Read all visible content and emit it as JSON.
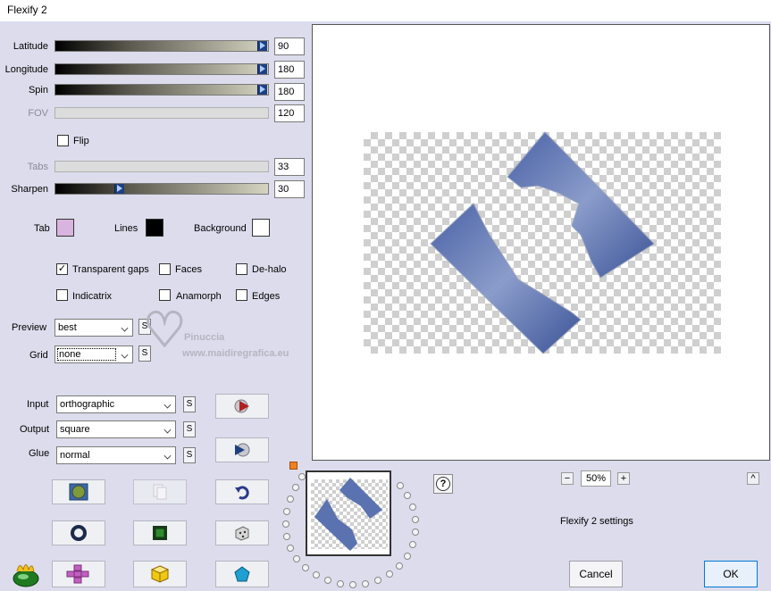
{
  "window": {
    "title": "Flexify 2"
  },
  "sliders": [
    {
      "label": "Latitude",
      "value": "90",
      "level_percent": 100,
      "enabled": true
    },
    {
      "label": "Longitude",
      "value": "180",
      "level_percent": 100,
      "enabled": true
    },
    {
      "label": "Spin",
      "value": "180",
      "level_percent": 100,
      "enabled": true
    },
    {
      "label": "FOV",
      "value": "120",
      "level_percent": 0,
      "enabled": false
    },
    {
      "label": "Tabs",
      "value": "33",
      "level_percent": 0,
      "enabled": false
    },
    {
      "label": "Sharpen",
      "value": "30",
      "level_percent": 30,
      "enabled": true
    }
  ],
  "flip": {
    "label": "Flip",
    "checked": false
  },
  "colors": {
    "tab": {
      "label": "Tab",
      "color": "#d9b4de"
    },
    "lines": {
      "label": "Lines",
      "color": "#000000"
    },
    "background": {
      "label": "Background",
      "color": "#ffffff"
    }
  },
  "options": {
    "transparent_gaps": {
      "label": "Transparent gaps",
      "checked": true
    },
    "faces": {
      "label": "Faces",
      "checked": false
    },
    "de_halo": {
      "label": "De-halo",
      "checked": false
    },
    "indicatrix": {
      "label": "Indicatrix",
      "checked": false
    },
    "anamorph": {
      "label": "Anamorph",
      "checked": false
    },
    "edges": {
      "label": "Edges",
      "checked": false
    }
  },
  "preview_select": {
    "label": "Preview",
    "value": "best"
  },
  "grid_select": {
    "label": "Grid",
    "value": "none"
  },
  "input_select": {
    "label": "Input",
    "value": "orthographic"
  },
  "output_select": {
    "label": "Output",
    "value": "square"
  },
  "glue_select": {
    "label": "Glue",
    "value": "normal"
  },
  "s_label": "S",
  "watermark": {
    "line1": "Pinuccia",
    "line2": "www.maidiregrafica.eu"
  },
  "zoom": {
    "minus": "−",
    "value": "50%",
    "plus": "+"
  },
  "up_label": "^",
  "help_label": "?",
  "settings_label": "Flexify 2 settings",
  "buttons": {
    "cancel": "Cancel",
    "ok": "OK"
  },
  "accent_color": "#0078d7"
}
